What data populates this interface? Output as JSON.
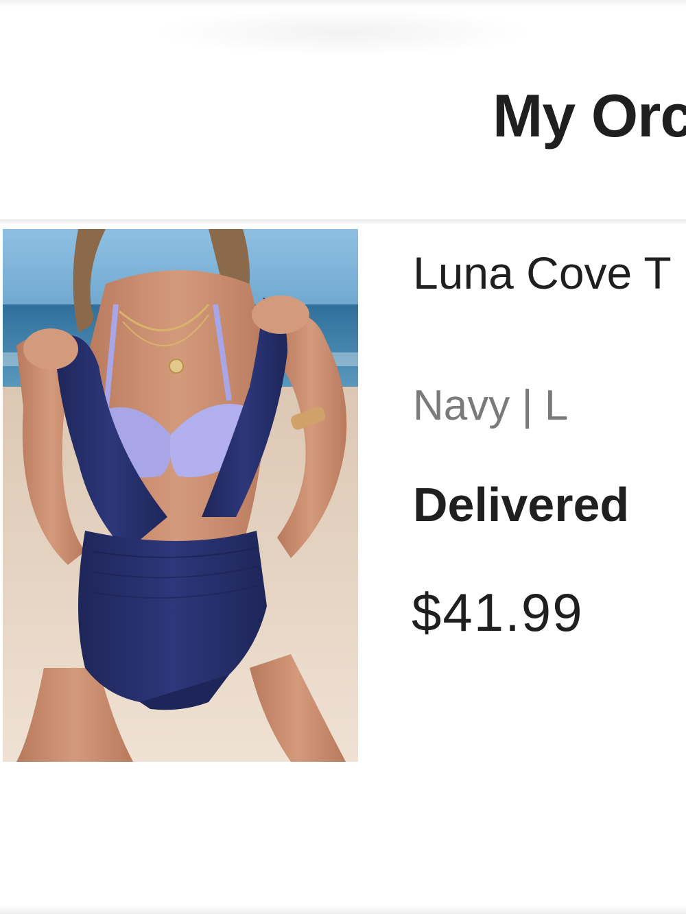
{
  "header": {
    "title": "My Orc"
  },
  "order_item": {
    "product_name": "Luna Cove T",
    "variant": "Navy | L",
    "status": "Delivered",
    "price": "$41.99",
    "image": {
      "icon": "product-photo",
      "colors": {
        "sky": "#7fb3d8",
        "sea": "#3f7fa8",
        "sand": "#e7d3c0",
        "skin": "#c98d6e",
        "swimsuit_navy": "#262f6b",
        "bikini_lavender": "#a8a6e6",
        "hair": "#8a6a4a"
      }
    }
  }
}
